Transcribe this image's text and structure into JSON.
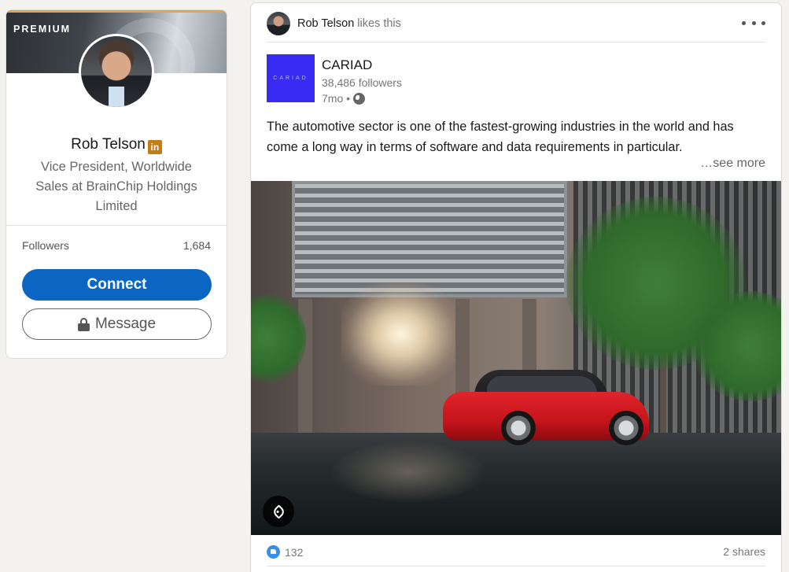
{
  "profile": {
    "badge": "PREMIUM",
    "name": "Rob Telson",
    "network_badge": "in",
    "headline": "Vice President, Worldwide Sales at BrainChip Holdings Limited",
    "followers_label": "Followers",
    "followers_count": "1,684",
    "connect_label": "Connect",
    "message_label": "Message"
  },
  "post": {
    "actor_name": "Rob Telson",
    "activity_text": "likes this",
    "company": {
      "logo_text": "CARIAD",
      "name": "CARIAD",
      "followers": "38,486 followers",
      "time": "7mo •",
      "logo_color": "#3a2bf4"
    },
    "text": "The automotive sector is one of the fastest-growing industries in the world and has come a long way in terms of software and data requirements in particular.",
    "see_more": "…see more",
    "reaction_count": "132",
    "shares": "2 shares"
  },
  "colors": {
    "accent": "#0a66c2",
    "premium": "#c37d16",
    "like": "#378fe9"
  }
}
